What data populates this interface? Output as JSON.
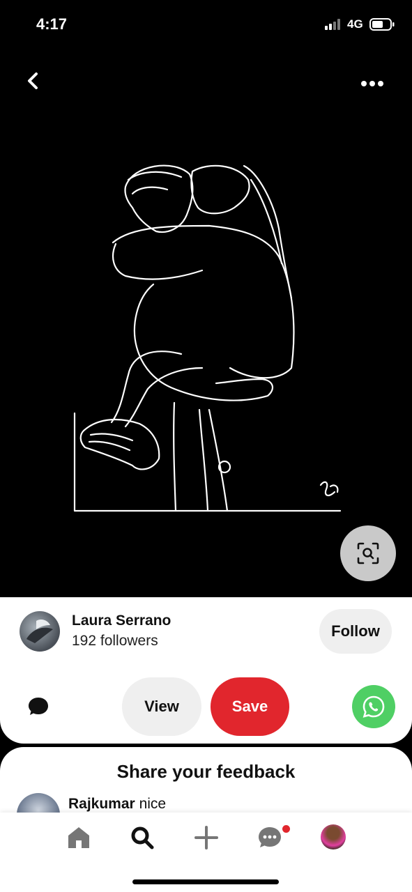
{
  "status_bar": {
    "time": "4:17",
    "network": "4G"
  },
  "pin": {
    "icons": {
      "back": "chevron-left-icon",
      "more": "more-horizontal-icon",
      "visual_search": "visual-search-icon"
    }
  },
  "creator": {
    "name": "Laura Serrano",
    "followers": "192 followers",
    "follow_label": "Follow"
  },
  "actions": {
    "view_label": "View",
    "save_label": "Save",
    "save_color": "#e1262d",
    "whatsapp_color": "#4fcf64"
  },
  "feedback": {
    "title": "Share your feedback",
    "comment": {
      "author": "Rajkumar",
      "text": "nice"
    }
  },
  "nav": {
    "items": [
      "home-icon",
      "search-icon",
      "plus-icon",
      "messages-icon",
      "profile-avatar"
    ],
    "notification_color": "#e1262d"
  }
}
